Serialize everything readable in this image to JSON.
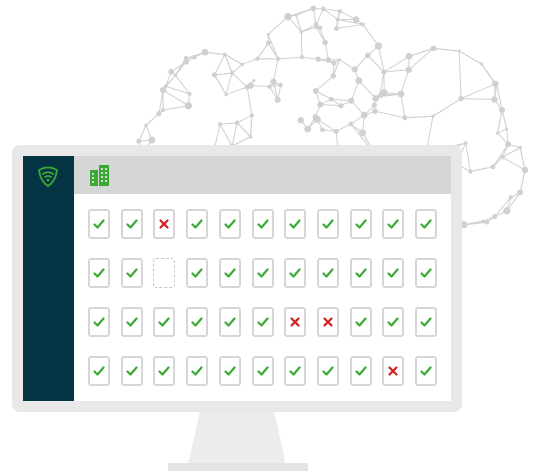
{
  "colors": {
    "sidebar": "#053444",
    "brand_green": "#3aaa35",
    "status_ok": "#3aaa35",
    "status_error": "#d41f1f",
    "bezel": "#e8e8e8",
    "topbar": "#d6d6d6",
    "cloud_lines": "#d0d0d0"
  },
  "icons": {
    "logo": "shield-wifi-icon",
    "org": "building-icon",
    "ok": "checkmark-icon",
    "error": "x-icon"
  },
  "device_grid": {
    "rows": [
      [
        "ok",
        "ok",
        "error",
        "ok",
        "ok",
        "ok",
        "ok",
        "ok",
        "ok",
        "ok",
        "ok"
      ],
      [
        "ok",
        "ok",
        "empty",
        "ok",
        "ok",
        "ok",
        "ok",
        "ok",
        "ok",
        "ok",
        "ok"
      ],
      [
        "ok",
        "ok",
        "ok",
        "ok",
        "ok",
        "ok",
        "error",
        "error",
        "ok",
        "ok",
        "ok"
      ],
      [
        "ok",
        "ok",
        "ok",
        "ok",
        "ok",
        "ok",
        "ok",
        "ok",
        "ok",
        "error",
        "ok"
      ]
    ]
  }
}
